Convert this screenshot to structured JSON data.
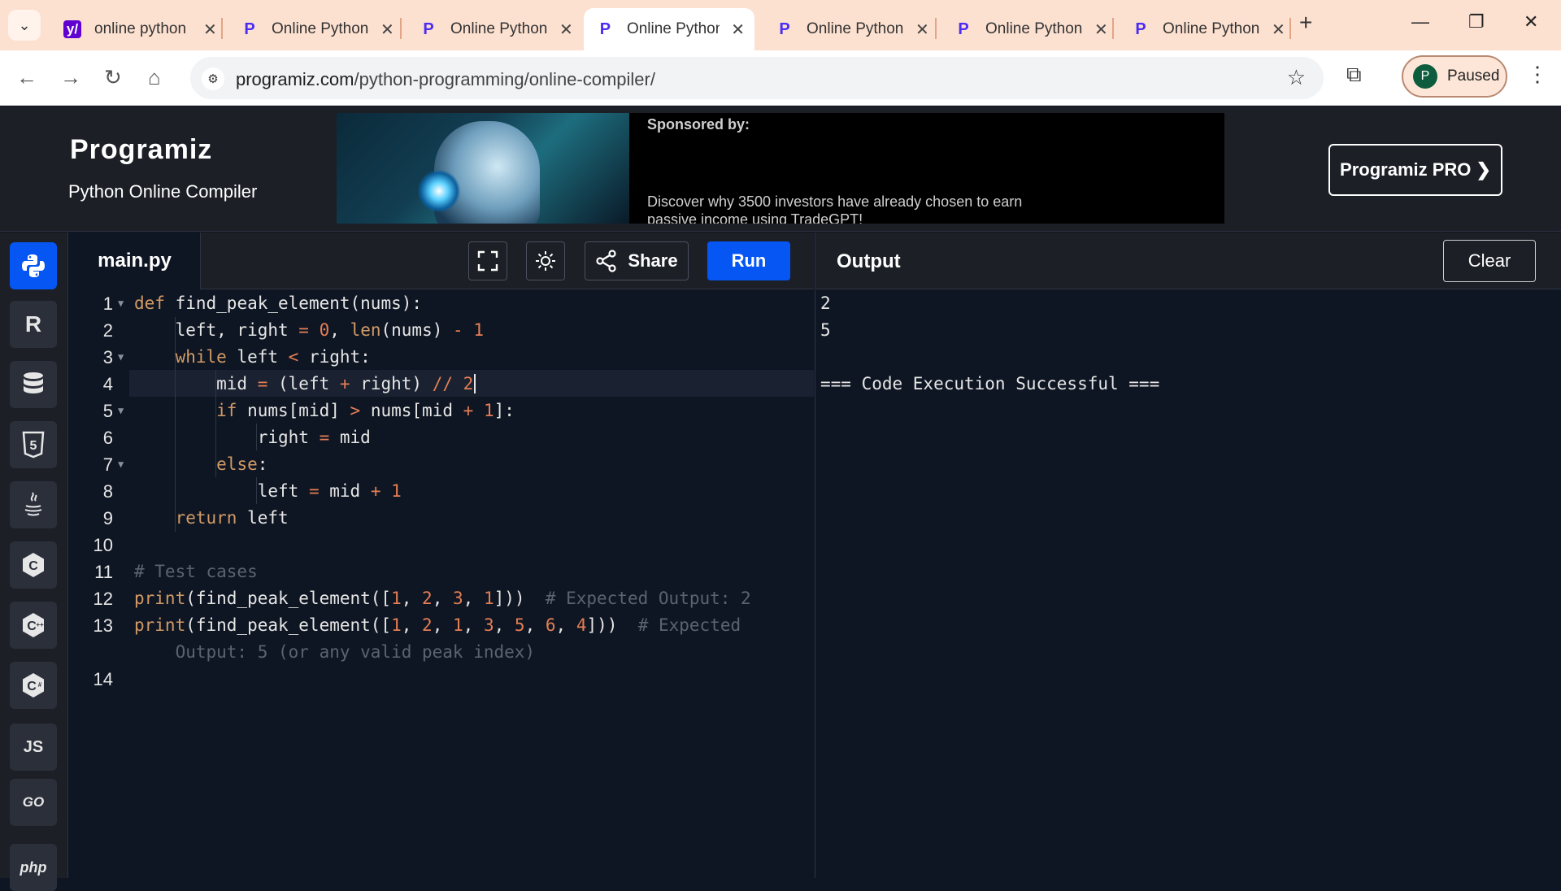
{
  "browser": {
    "tabs": [
      {
        "title": "online python",
        "favicon": "yahoo-icon",
        "active": false
      },
      {
        "title": "Online Python",
        "favicon": "programiz-icon",
        "active": false
      },
      {
        "title": "Online Python",
        "favicon": "programiz-icon",
        "active": false
      },
      {
        "title": "Online Python",
        "favicon": "programiz-icon",
        "active": true
      },
      {
        "title": "Online Python",
        "favicon": "programiz-icon",
        "active": false
      },
      {
        "title": "Online Python",
        "favicon": "programiz-icon",
        "active": false
      },
      {
        "title": "Online Python",
        "favicon": "programiz-icon",
        "active": false
      }
    ],
    "url_domain": "programiz.com",
    "url_path": "/python-programming/online-compiler/",
    "profile_initial": "P",
    "profile_status": "Paused"
  },
  "header": {
    "logo": "Programiz",
    "subtitle": "Python Online Compiler",
    "ad_sponsor": "Sponsored by:",
    "ad_text": "Discover why 3500 investors have already chosen to earn passive income using TradeGPT!",
    "pro_button": "Programiz PRO ❯"
  },
  "rail": {
    "languages": [
      {
        "name": "python",
        "label": "",
        "active": true
      },
      {
        "name": "r",
        "label": "R",
        "active": false
      },
      {
        "name": "sql",
        "label": "",
        "active": false
      },
      {
        "name": "html",
        "label": "5",
        "active": false
      },
      {
        "name": "java",
        "label": "",
        "active": false
      },
      {
        "name": "c",
        "label": "C",
        "active": false
      },
      {
        "name": "cpp",
        "label": "C",
        "active": false
      },
      {
        "name": "csharp",
        "label": "C",
        "active": false
      },
      {
        "name": "javascript",
        "label": "JS",
        "active": false
      },
      {
        "name": "go",
        "label": "GO",
        "active": false
      },
      {
        "name": "php",
        "label": "php",
        "active": false
      }
    ]
  },
  "editor": {
    "filename": "main.py",
    "share_label": "Share",
    "run_label": "Run",
    "line_numbers": [
      "1",
      "2",
      "3",
      "4",
      "5",
      "6",
      "7",
      "8",
      "9",
      "10",
      "11",
      "12",
      "13",
      "14"
    ]
  },
  "output": {
    "title": "Output",
    "clear_label": "Clear",
    "lines": [
      "2",
      "5",
      "",
      "=== Code Execution Successful ==="
    ]
  },
  "colors": {
    "accent": "#0556f3",
    "background": "#0f1623",
    "panel": "#1c1f26"
  }
}
